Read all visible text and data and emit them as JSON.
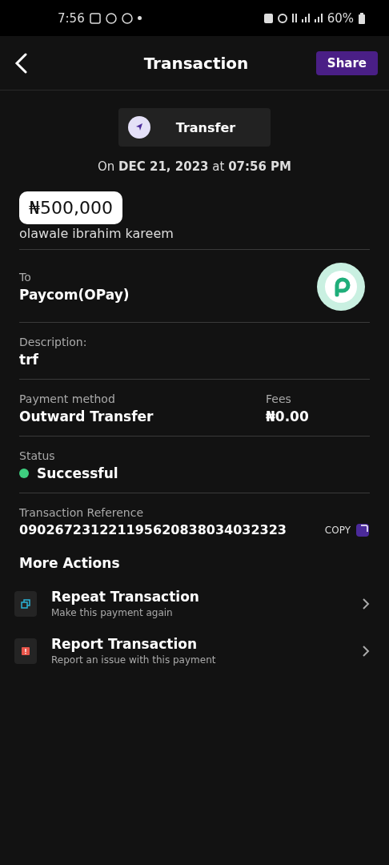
{
  "status_bar": {
    "time": "7:56",
    "battery": "60%"
  },
  "header": {
    "title": "Transaction",
    "share_button": "Share"
  },
  "type_chip": {
    "label": "Transfer"
  },
  "date_line": "On **DEC 21, 2023** at **07:56 PM**",
  "amount": "₦500,000",
  "sender": "olawale ibrahim kareem",
  "recipient": {
    "label": "To",
    "value": "Paycom(OPay)"
  },
  "description": {
    "label": "Description:",
    "value": "trf"
  },
  "payment_method": {
    "label": "Payment method",
    "value": "Outward Transfer"
  },
  "fees": {
    "label": "Fees",
    "value": "₦0.00"
  },
  "status": {
    "label": "Status",
    "value": "Successful",
    "color": "#3ecf7f"
  },
  "reference": {
    "label": "Transaction Reference",
    "value": "090267231221195620838034032323",
    "copy": "COPY"
  },
  "more_actions": {
    "title": "More Actions",
    "items": [
      {
        "kind": "repeat",
        "title": "Repeat Transaction",
        "subtitle": "Make this payment again"
      },
      {
        "kind": "report",
        "title": "Report Transaction",
        "subtitle": "Report an issue with this payment"
      }
    ]
  }
}
